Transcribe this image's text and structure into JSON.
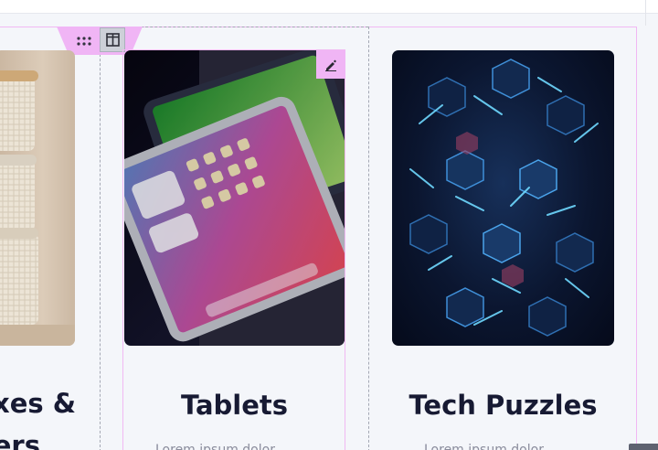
{
  "toolbar": {
    "drag_handle_icon": "grip-dots-icon",
    "column_icon": "columns-icon"
  },
  "cards": [
    {
      "title_line1": "xes &",
      "title_line2": "ers",
      "image_icon": "storage-boxes-image"
    },
    {
      "title": "Tablets",
      "description": "Lorem ipsum dolor",
      "image_icon": "tablet-image",
      "edit_icon": "pencil-icon"
    },
    {
      "title": "Tech Puzzles",
      "description": "Lorem ipsum dolor",
      "image_icon": "puzzle-image"
    }
  ],
  "colors": {
    "selection_accent": "#f0b5f5",
    "title_text": "#171a33",
    "page_bg": "#f4f6fa"
  }
}
